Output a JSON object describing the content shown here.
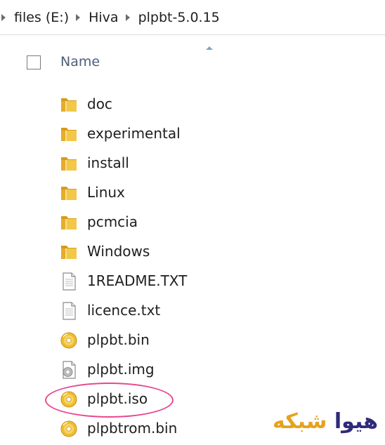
{
  "breadcrumb": {
    "items": [
      "files (E:)",
      "Hiva",
      "plpbt-5.0.15"
    ]
  },
  "header": {
    "name_label": "Name"
  },
  "files": [
    {
      "name": "doc",
      "type": "folder"
    },
    {
      "name": "experimental",
      "type": "folder"
    },
    {
      "name": "install",
      "type": "folder"
    },
    {
      "name": "Linux",
      "type": "folder"
    },
    {
      "name": "pcmcia",
      "type": "folder"
    },
    {
      "name": "Windows",
      "type": "folder"
    },
    {
      "name": "1README.TXT",
      "type": "text"
    },
    {
      "name": "licence.txt",
      "type": "text"
    },
    {
      "name": "plpbt.bin",
      "type": "disc"
    },
    {
      "name": "plpbt.img",
      "type": "image"
    },
    {
      "name": "plpbt.iso",
      "type": "disc"
    },
    {
      "name": "plpbtrom.bin",
      "type": "disc"
    }
  ],
  "highlighted_file": "plpbt.iso",
  "watermark": {
    "part1": "هیوا",
    "part2": "شبکه"
  },
  "colors": {
    "folder": "#e8b830",
    "highlight": "#e8478f",
    "header_text": "#4c607a",
    "watermark_primary": "#2f2a7a",
    "watermark_accent": "#e6a21f"
  }
}
